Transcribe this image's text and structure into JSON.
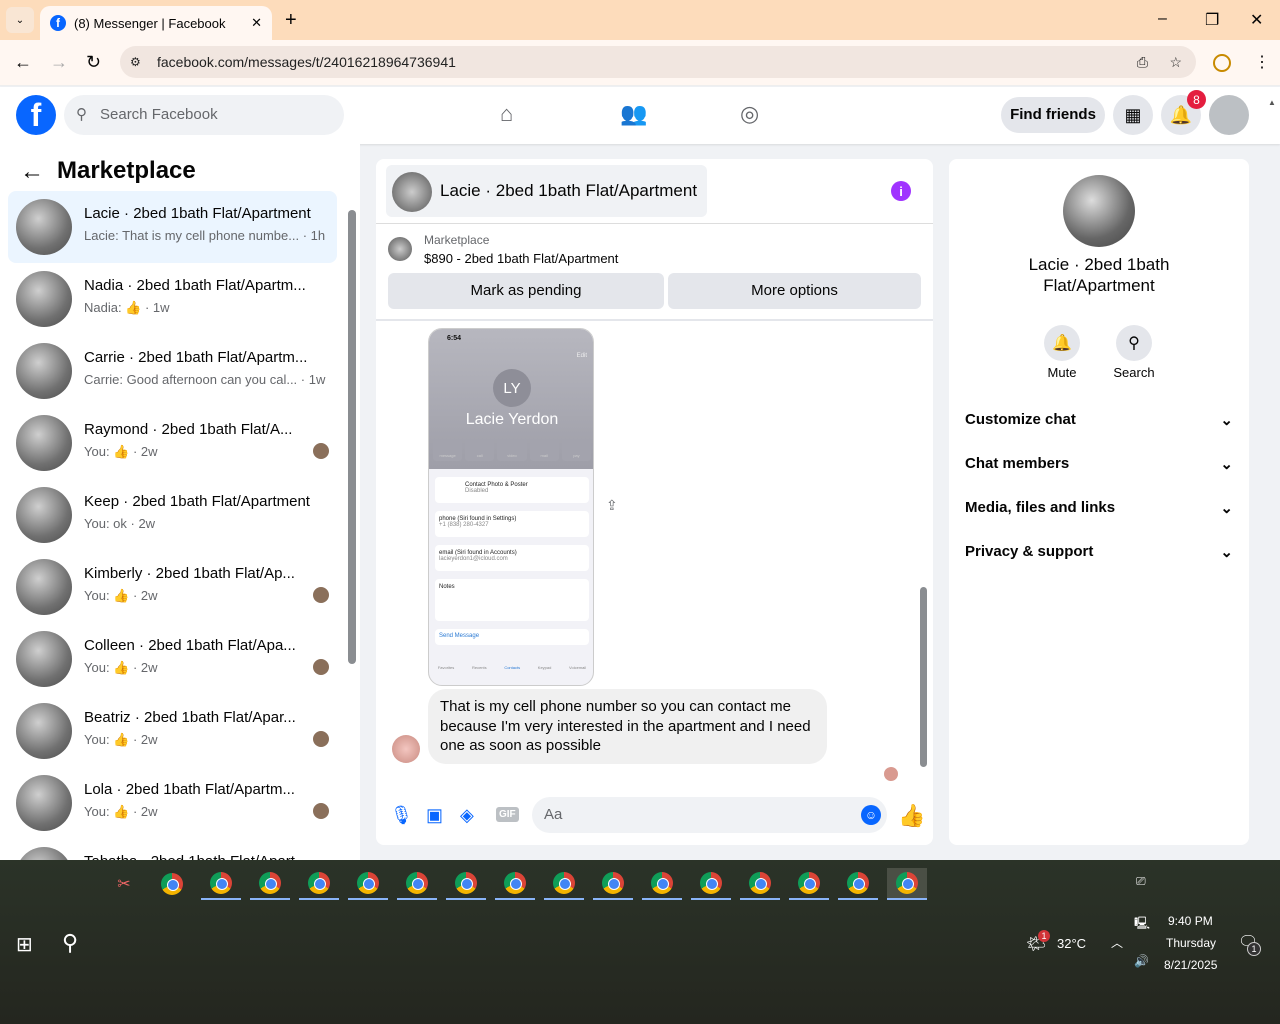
{
  "browser": {
    "tab_title": "(8) Messenger | Facebook",
    "url": "facebook.com/messages/t/24016218964736941"
  },
  "fb": {
    "search_placeholder": "Search Facebook",
    "find_friends": "Find friends",
    "notif_count": "8"
  },
  "sidebar": {
    "title": "Marketplace",
    "items": [
      {
        "name": "Lacie · 2bed 1bath Flat/Apartment",
        "sub": "Lacie: That is my cell phone numbe... · 1h",
        "active": true
      },
      {
        "name": "Nadia · 2bed 1bath Flat/Apartm...",
        "sub": "Nadia: 👍 · 1w"
      },
      {
        "name": "Carrie · 2bed 1bath Flat/Apartm...",
        "sub": "Carrie: Good afternoon can you cal... · 1w"
      },
      {
        "name": "Raymond · 2bed 1bath Flat/A...",
        "sub": "You: 👍 · 2w",
        "seen": true
      },
      {
        "name": "Keep · 2bed 1bath Flat/Apartment",
        "sub": "You: ok · 2w"
      },
      {
        "name": "Kimberly · 2bed 1bath Flat/Ap...",
        "sub": "You: 👍 · 2w",
        "seen": true
      },
      {
        "name": "Colleen · 2bed 1bath Flat/Apa...",
        "sub": "You: 👍 · 2w",
        "seen": true
      },
      {
        "name": "Beatriz · 2bed 1bath Flat/Apar...",
        "sub": "You: 👍 · 2w",
        "seen": true
      },
      {
        "name": "Lola · 2bed 1bath Flat/Apartm...",
        "sub": "You: 👍 · 2w",
        "seen": true
      },
      {
        "name": "Tabatha · 2bed 1bath Flat/Apart...",
        "sub": ""
      }
    ]
  },
  "chat": {
    "title": "Lacie · 2bed 1bath Flat/Apartment",
    "listing_label": "Marketplace",
    "listing": "$890 - 2bed 1bath Flat/Apartment",
    "mark_pending": "Mark as pending",
    "more_options": "More options",
    "screenshot": {
      "time": "6:54",
      "edit": "Edit",
      "initials": "LY",
      "contact": "Lacie Yerdon",
      "actions": [
        "message",
        "call",
        "video",
        "mail",
        "pay"
      ],
      "photo_poster": "Contact Photo & Poster",
      "photo_status": "Disabled",
      "phone_label": "phone (Siri found in Settings)",
      "phone": "+1 (838) 280-4327",
      "email_label": "email (Siri found in Accounts)",
      "email": "lacieyerdon1@icloud.com",
      "notes": "Notes",
      "send": "Send Message",
      "tabs": [
        "Favorites",
        "Recents",
        "Contacts",
        "Keypad",
        "Voicemail"
      ]
    },
    "message": "That is my cell phone number so you can contact me because I'm very interested in the apartment and I need one as soon as possible",
    "input_placeholder": "Aa"
  },
  "right": {
    "name": "Lacie · 2bed 1bath Flat/Apartment",
    "mute": "Mute",
    "search": "Search",
    "sections": [
      "Customize chat",
      "Chat members",
      "Media, files and links",
      "Privacy & support"
    ]
  },
  "taskbar": {
    "temp": "32°C",
    "weather_badge": "1",
    "time": "9:40 PM",
    "day": "Thursday",
    "date": "8/21/2025",
    "notif": "1"
  },
  "colors": {
    "fb_blue": "#0866ff",
    "accent_purple": "#a033ff"
  }
}
